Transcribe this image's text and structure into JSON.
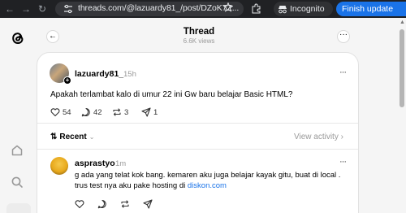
{
  "browser": {
    "url": "threads.com/@lazuardy81_/post/DZoK7Z...",
    "incognito_label": "Incognito",
    "finish_update_label": "Finish update"
  },
  "header": {
    "title": "Thread",
    "views": "6.6K views"
  },
  "post": {
    "username": "lazuardy81_",
    "time": "15h",
    "text": "Apakah terlambat kalo di umur 22 ini Gw baru belajar Basic HTML?",
    "likes": "54",
    "comments": "42",
    "reposts": "3",
    "shares": "1"
  },
  "sort": {
    "label": "Recent",
    "view_activity": "View activity"
  },
  "reply": {
    "username": "asprastyo",
    "time": "1m",
    "text": "g ada yang telat kok bang. kemaren aku juga belajar kayak gitu, buat di local . trus test nya aku pake hosting di ",
    "link": "diskon.com"
  },
  "icons": {
    "logo": "threads-logo-icon",
    "home": "home-icon",
    "search": "search-icon",
    "like": "heart-icon",
    "comment": "comment-icon",
    "repost": "repost-icon",
    "share": "share-icon"
  }
}
